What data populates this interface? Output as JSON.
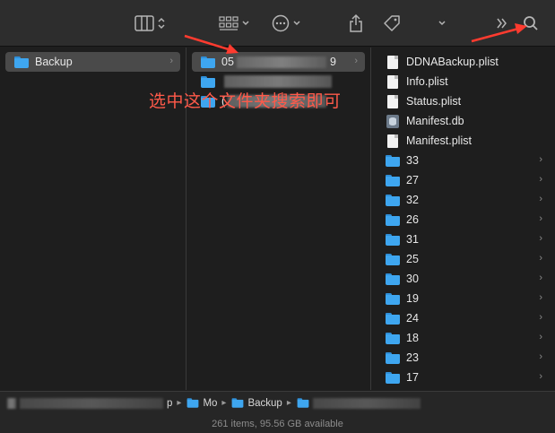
{
  "toolbar": {
    "view_icon": "column-view-icon",
    "group_icon": "group-icon",
    "action_icon": "ellipsis-circle-icon",
    "share_icon": "share-icon",
    "tag_icon": "tag-icon",
    "more_icon": "double-chevron-icon",
    "search_icon": "search-icon"
  },
  "column1": {
    "items": [
      {
        "label": "Backup",
        "icon": "folder-icon",
        "selected": true
      }
    ]
  },
  "column2": {
    "items": [
      {
        "label_prefix": "05",
        "label_suffix": "9",
        "icon": "folder-icon",
        "selected": true
      },
      {
        "label_prefix": "",
        "label_suffix": "",
        "icon": "folder-icon"
      },
      {
        "label_prefix": "(",
        "label_suffix": "",
        "icon": "folder-icon"
      }
    ]
  },
  "column3": {
    "items": [
      {
        "label": "DDNABackup.plist",
        "icon": "document-icon",
        "has_arrow": false
      },
      {
        "label": "Info.plist",
        "icon": "document-icon",
        "has_arrow": false
      },
      {
        "label": "Status.plist",
        "icon": "document-icon",
        "has_arrow": false
      },
      {
        "label": "Manifest.db",
        "icon": "database-icon",
        "has_arrow": false
      },
      {
        "label": "Manifest.plist",
        "icon": "document-icon",
        "has_arrow": false
      },
      {
        "label": "33",
        "icon": "folder-icon",
        "has_arrow": true
      },
      {
        "label": "27",
        "icon": "folder-icon",
        "has_arrow": true
      },
      {
        "label": "32",
        "icon": "folder-icon",
        "has_arrow": true
      },
      {
        "label": "26",
        "icon": "folder-icon",
        "has_arrow": true
      },
      {
        "label": "31",
        "icon": "folder-icon",
        "has_arrow": true
      },
      {
        "label": "25",
        "icon": "folder-icon",
        "has_arrow": true
      },
      {
        "label": "30",
        "icon": "folder-icon",
        "has_arrow": true
      },
      {
        "label": "19",
        "icon": "folder-icon",
        "has_arrow": true
      },
      {
        "label": "24",
        "icon": "folder-icon",
        "has_arrow": true
      },
      {
        "label": "18",
        "icon": "folder-icon",
        "has_arrow": true
      },
      {
        "label": "23",
        "icon": "folder-icon",
        "has_arrow": true
      },
      {
        "label": "17",
        "icon": "folder-icon",
        "has_arrow": true
      }
    ]
  },
  "annotation": {
    "text": "选中这个文件夹搜索即可",
    "color": "#ff5a4a"
  },
  "pathbar": {
    "crumbs": [
      {
        "label": "",
        "icon": "folder-icon"
      },
      {
        "label": "p",
        "icon": ""
      },
      {
        "label": "Mo",
        "icon": "folder-icon"
      },
      {
        "label": "Backup",
        "icon": "folder-icon"
      },
      {
        "label": "",
        "icon": "folder-icon"
      }
    ]
  },
  "status": {
    "text": "261 items, 95.56 GB available"
  },
  "colors": {
    "folder": "#3ea6f0",
    "selection": "#4a4a4a",
    "background": "#1e1e1e",
    "toolbar": "#2d2d2d"
  }
}
